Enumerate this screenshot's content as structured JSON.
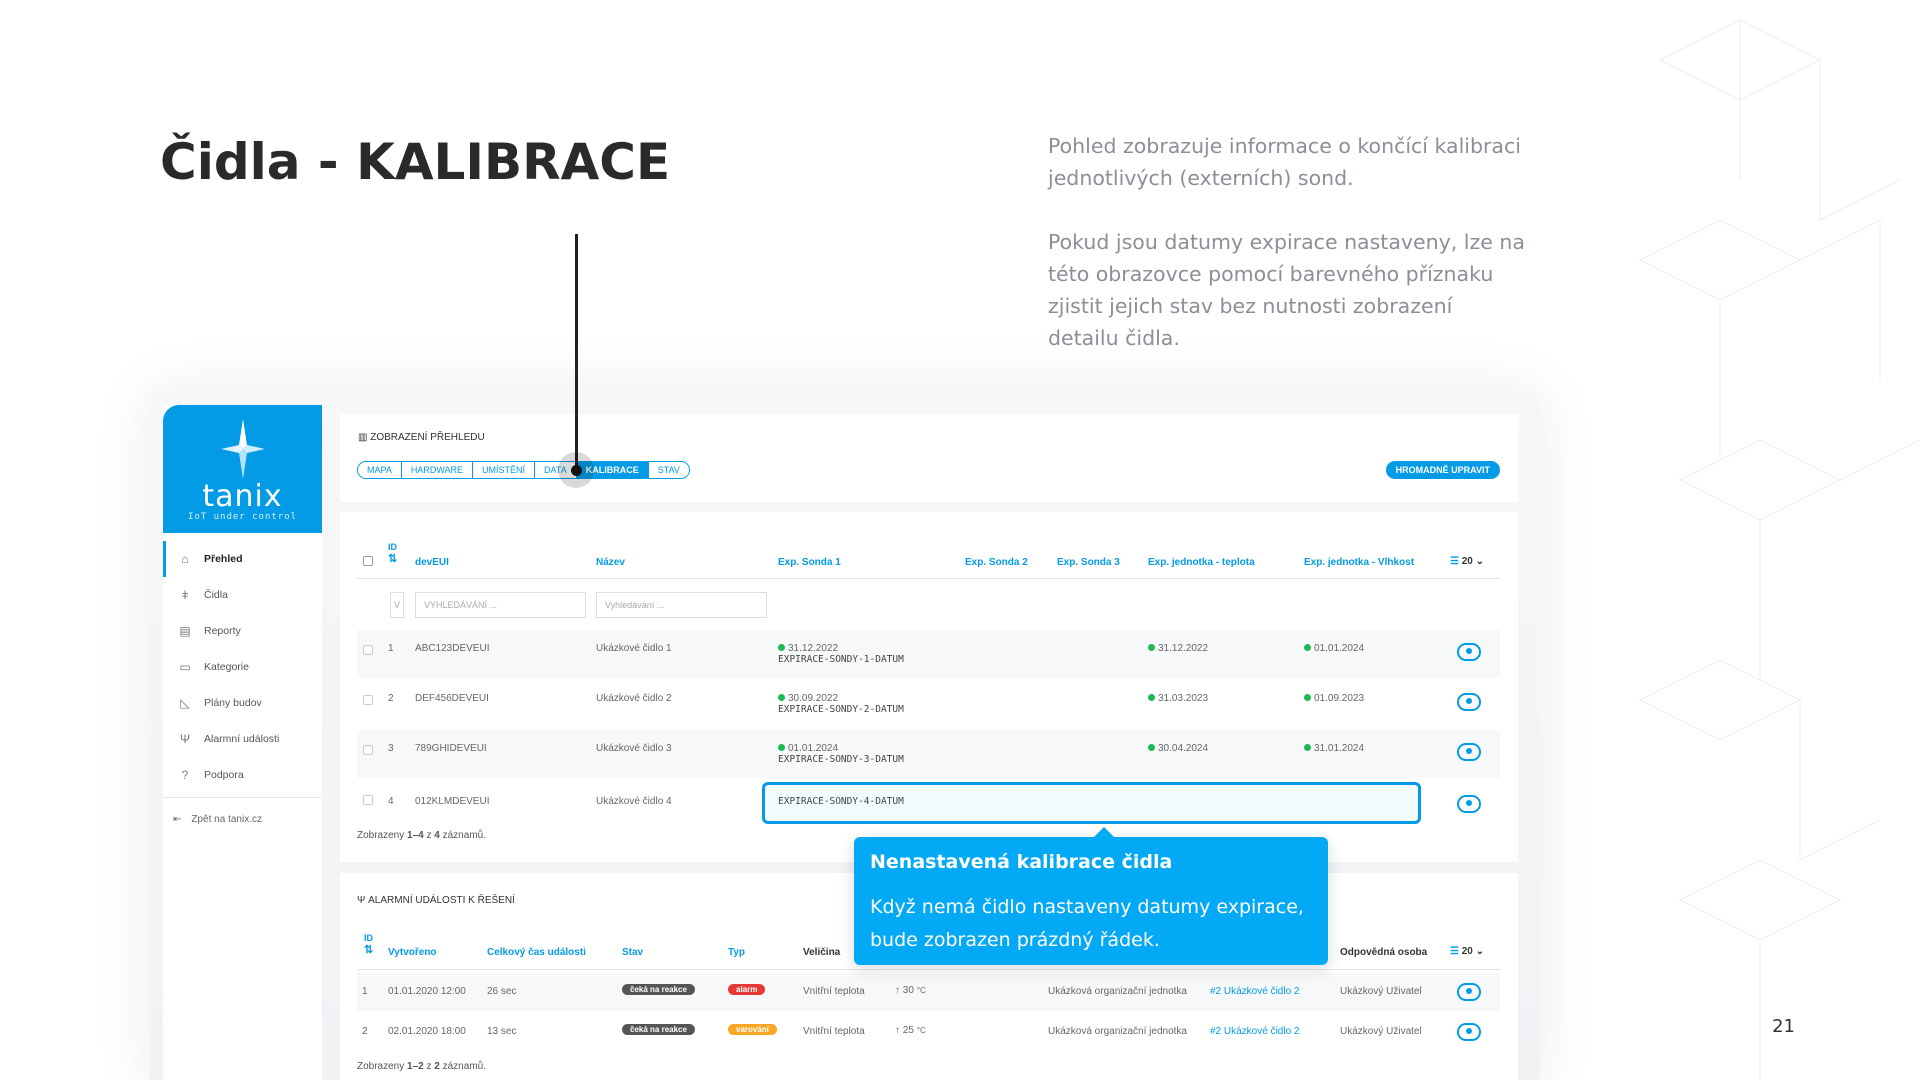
{
  "slide": {
    "title": "Čidla - KALIBRACE",
    "desc1": "Pohled zobrazuje informace o končící kalibraci jednotlivých (externích) sond.",
    "desc2": "Pokud jsou datumy expirace nastaveny, lze na této obrazovce pomocí barevného příznaku zjistit jejich stav bez nutnosti zobrazení detailu čidla.",
    "page_number": "21"
  },
  "brand": {
    "name": "tanix",
    "tagline": "IoT under control",
    "color": "#039be5"
  },
  "sidebar": {
    "items": [
      {
        "label": "Přehled",
        "icon": "home-icon",
        "glyph": "⌂"
      },
      {
        "label": "Čidla",
        "icon": "thermometer-icon",
        "glyph": "🌡"
      },
      {
        "label": "Reporty",
        "icon": "report-icon",
        "glyph": "▤"
      },
      {
        "label": "Kategorie",
        "icon": "folder-icon",
        "glyph": "▭"
      },
      {
        "label": "Plány budov",
        "icon": "floorplan-icon",
        "glyph": "◺"
      },
      {
        "label": "Alarmní události",
        "icon": "antenna-icon",
        "glyph": "Ψ"
      },
      {
        "label": "Podpora",
        "icon": "help-icon",
        "glyph": "?"
      }
    ],
    "back": {
      "label": "Zpět na tanix.cz",
      "glyph": "⇤"
    }
  },
  "view": {
    "title": "ZOBRAZENÍ PŘEHLEDU",
    "tabs": [
      "MAPA",
      "HARDWARE",
      "UMÍSTĚNÍ",
      "DATA",
      "KALIBRACE",
      "STAV"
    ],
    "active_tab": "KALIBRACE",
    "bulk_edit": "HROMADNĚ UPRAVIT"
  },
  "cal_table": {
    "headers": {
      "id": "ID",
      "deveui": "devEUI",
      "name": "Název",
      "sonda1": "Exp. Sonda 1",
      "sonda2": "Exp. Sonda 2",
      "sonda3": "Exp. Sonda 3",
      "unit_temp": "Exp. jednotka - teplota",
      "unit_hum": "Exp. jednotka - Vlhkost"
    },
    "page_size": "20",
    "search_placeholder": "VYHLEDÁVÁNÍ ...",
    "name_placeholder": "Vyhledávání ...",
    "id_filter": "V",
    "rows": [
      {
        "id": "1",
        "deveui": "ABC123DEVEUI",
        "name": "Ukázkové čidlo 1",
        "s1_date": "31.12.2022",
        "s1_label": "EXPIRACE-SONDY-1-DATUM",
        "temp": "31.12.2022",
        "hum": "01.01.2024"
      },
      {
        "id": "2",
        "deveui": "DEF456DEVEUI",
        "name": "Ukázkové čidlo 2",
        "s1_date": "30.09.2022",
        "s1_label": "EXPIRACE-SONDY-2-DATUM",
        "temp": "31.03.2023",
        "hum": "01.09.2023"
      },
      {
        "id": "3",
        "deveui": "789GHIDEVEUI",
        "name": "Ukázkové čidlo 3",
        "s1_date": "01.01.2024",
        "s1_label": "EXPIRACE-SONDY-3-DATUM",
        "temp": "30.04.2024",
        "hum": "31.01.2024"
      },
      {
        "id": "4",
        "deveui": "012KLMDEVEUI",
        "name": "Ukázkové čidlo 4",
        "s1_label": "EXPIRACE-SONDY-4-DATUM"
      }
    ],
    "footer": {
      "pre": "Zobrazeny ",
      "range": "1–4",
      "mid": " z ",
      "total": "4",
      "post": " záznamů."
    }
  },
  "tooltip": {
    "title": "Nenastavená kalibrace čidla",
    "body": "Když nemá čidlo nastaveny datumy expirace, bude zobrazen prázdný řádek."
  },
  "alarm_table": {
    "title": "ALARMNÍ UDÁLOSTI K ŘEŠENÍ",
    "headers": {
      "id": "ID",
      "created": "Vytvořeno",
      "duration": "Celkový čas události",
      "state": "Stav",
      "type": "Typ",
      "quantity": "Veličina",
      "person": "Odpovědná osoba"
    },
    "page_size": "20",
    "rows": [
      {
        "id": "1",
        "created": "01.01.2020 12:00",
        "duration": "26 sec",
        "state": "čeká na reakce",
        "type": "alarm",
        "type_color": "#e53935",
        "quantity": "Vnitřní teplota",
        "value": "30",
        "unit": "°C",
        "org": "Ukázková organizační jednotka",
        "sensor": "#2 Ukázkové čidlo 2",
        "person": "Ukázkový Uživatel"
      },
      {
        "id": "2",
        "created": "02.01.2020 18:00",
        "duration": "13 sec",
        "state": "čeká na reakce",
        "type": "varování",
        "type_color": "#f9a825",
        "quantity": "Vnitřní teplota",
        "value": "25",
        "unit": "°C",
        "org": "Ukázková organizační jednotka",
        "sensor": "#2 Ukázkové čidlo 2",
        "person": "Ukázkový Uživatel"
      }
    ],
    "footer": {
      "pre": "Zobrazeny ",
      "range": "1–2",
      "mid": " z ",
      "total": "2",
      "post": " záznamů."
    }
  }
}
